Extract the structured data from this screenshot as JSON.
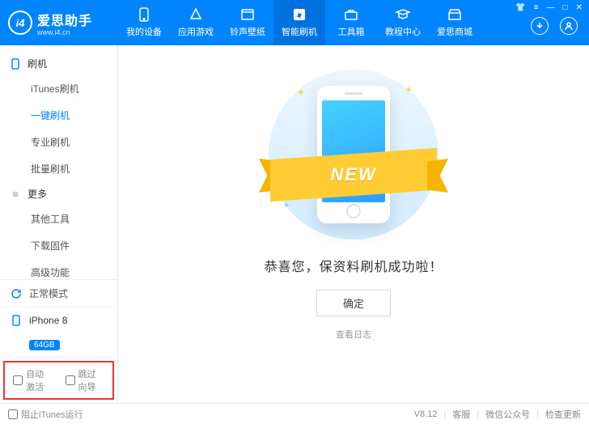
{
  "brand": {
    "name": "爱思助手",
    "url": "www.i4.cn",
    "mark": "i4"
  },
  "nav": [
    {
      "label": "我的设备",
      "icon": "device"
    },
    {
      "label": "应用游戏",
      "icon": "apps"
    },
    {
      "label": "铃声壁纸",
      "icon": "media"
    },
    {
      "label": "智能刷机",
      "icon": "flash",
      "active": true
    },
    {
      "label": "工具箱",
      "icon": "tools"
    },
    {
      "label": "教程中心",
      "icon": "tutorial"
    },
    {
      "label": "爱思商城",
      "icon": "store"
    }
  ],
  "sidebar": {
    "groups": [
      {
        "title": "刷机",
        "items": [
          "iTunes刷机",
          "一键刷机",
          "专业刷机",
          "批量刷机"
        ],
        "activeIndex": 1
      },
      {
        "title": "更多",
        "items": [
          "其他工具",
          "下载固件",
          "高级功能"
        ]
      }
    ],
    "mode": "正常模式",
    "device": {
      "name": "iPhone 8",
      "storage": "64GB"
    },
    "checks": {
      "autoActivate": "自动激活",
      "skipSetup": "跳过向导"
    }
  },
  "main": {
    "ribbon": "NEW",
    "message": "恭喜您，保资料刷机成功啦！",
    "ok": "确定",
    "viewLog": "查看日志"
  },
  "footer": {
    "blockItunes": "阻止iTunes运行",
    "version": "V8.12",
    "support": "客服",
    "wechat": "微信公众号",
    "update": "检查更新"
  }
}
